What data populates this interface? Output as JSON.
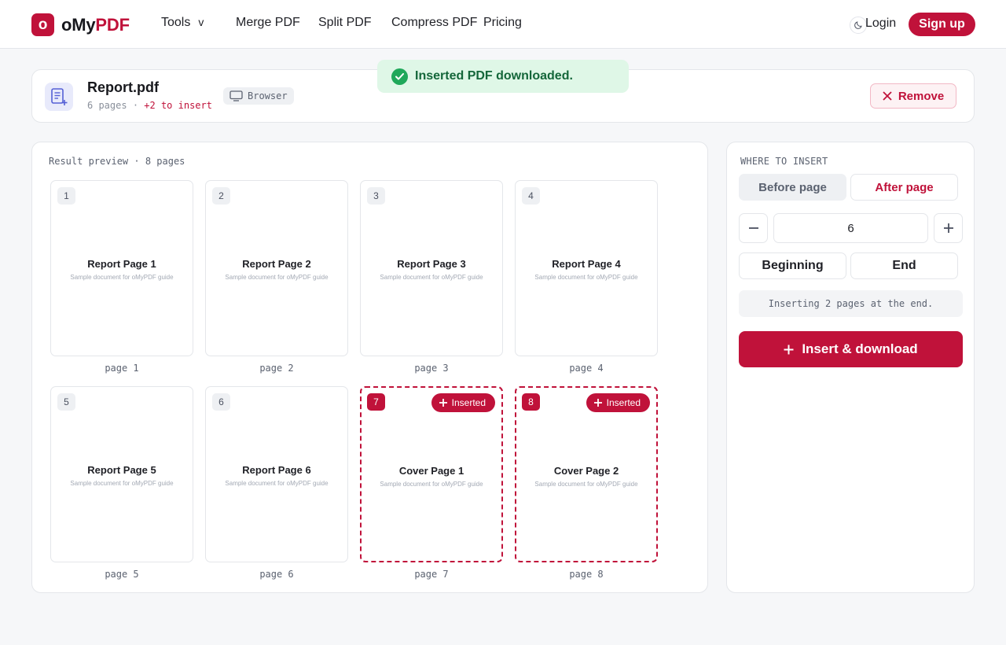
{
  "header": {
    "logo_mark": "o",
    "brand_prefix": "oMy",
    "brand_accent": "PDF",
    "nav": {
      "tools": "Tools",
      "tools_chevron": "v",
      "merge": "Merge PDF",
      "split": "Split PDF",
      "compress": "Compress PDF",
      "pricing": "Pricing"
    },
    "login": "Login",
    "signup": "Sign up"
  },
  "toast": {
    "message": "Inserted PDF downloaded."
  },
  "file": {
    "name": "Report.pdf",
    "pages_text": "6 pages",
    "separator": "·",
    "insert_text": "+2 to insert",
    "source_tag": "Browser",
    "remove_label": "Remove"
  },
  "preview": {
    "title": "Result preview · 8 pages",
    "inserted_label": "Inserted",
    "pages": [
      {
        "num": "1",
        "title": "Report Page 1",
        "subtitle": "Sample document for oMyPDF guide",
        "caption": "page 1",
        "inserted": false
      },
      {
        "num": "2",
        "title": "Report Page 2",
        "subtitle": "Sample document for oMyPDF guide",
        "caption": "page 2",
        "inserted": false
      },
      {
        "num": "3",
        "title": "Report Page 3",
        "subtitle": "Sample document for oMyPDF guide",
        "caption": "page 3",
        "inserted": false
      },
      {
        "num": "4",
        "title": "Report Page 4",
        "subtitle": "Sample document for oMyPDF guide",
        "caption": "page 4",
        "inserted": false
      },
      {
        "num": "5",
        "title": "Report Page 5",
        "subtitle": "Sample document for oMyPDF guide",
        "caption": "page 5",
        "inserted": false
      },
      {
        "num": "6",
        "title": "Report Page 6",
        "subtitle": "Sample document for oMyPDF guide",
        "caption": "page 6",
        "inserted": false
      },
      {
        "num": "7",
        "title": "Cover Page 1",
        "subtitle": "Sample document for oMyPDF guide",
        "caption": "page 7",
        "inserted": true
      },
      {
        "num": "8",
        "title": "Cover Page 2",
        "subtitle": "Sample document for oMyPDF guide",
        "caption": "page 8",
        "inserted": true
      }
    ]
  },
  "insert_panel": {
    "label": "WHERE TO INSERT",
    "before_label": "Before page",
    "after_label": "After page",
    "page_value": "6",
    "beginning_label": "Beginning",
    "end_label": "End",
    "status": "Inserting 2 pages at the end.",
    "action_label": "Insert & download"
  },
  "icons": {
    "theme": "moon-icon",
    "file": "document-add-icon",
    "source": "monitor-icon",
    "remove": "close-icon",
    "toast": "check-circle-icon",
    "inserted": "plus-icon",
    "decrement": "minus-icon",
    "increment": "plus-icon",
    "action": "plus-icon"
  },
  "colors": {
    "brand": "#c0123a",
    "success_bg": "#dff7e7",
    "success_text": "#14663a",
    "success_icon": "#1fa85a"
  }
}
